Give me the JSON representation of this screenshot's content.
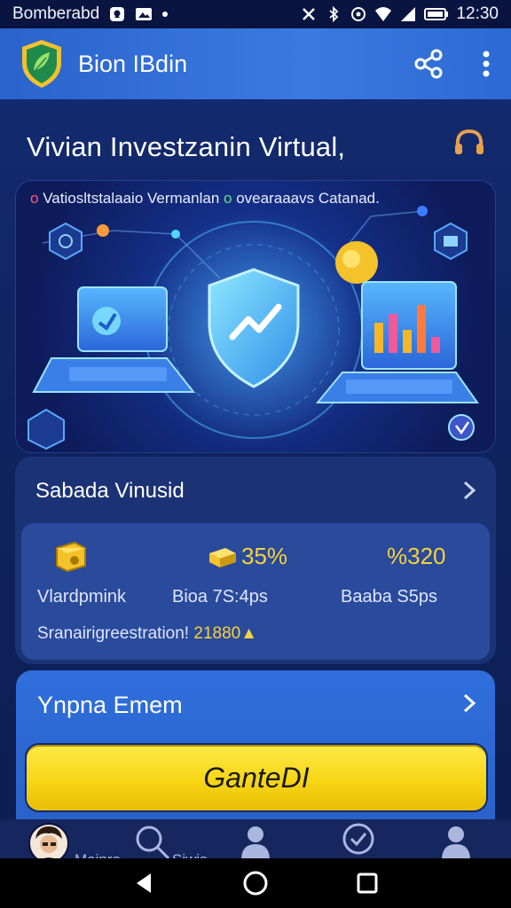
{
  "status_bar": {
    "carrier": "Bomberabd",
    "time": "12:30"
  },
  "app_bar": {
    "title": "Bion IBdin",
    "logo_icon": "shield-leaf-icon",
    "share_icon": "share-icon",
    "menu_icon": "more-vert-icon"
  },
  "main": {
    "headline": "Vivian Investzanin Virtual,",
    "headline_icon": "support-headset-icon",
    "hero": {
      "caption_part1": "Vatiosltstalaaio Vermanlan",
      "caption_part2": "ovearaaavs Catanad."
    },
    "card1": {
      "title": "Sabada Vinusid",
      "stats": [
        {
          "value": "",
          "label": "Vlardpmink",
          "icon": "coin-box-icon"
        },
        {
          "value": "35%",
          "label": "Bioa 7S:4ps",
          "icon": "gold-bars-icon"
        },
        {
          "value": "%320",
          "label": "Baaba S5ps",
          "icon": ""
        }
      ],
      "footer_text": "Sranairigreestration!",
      "footer_value": "21880▲"
    },
    "card2": {
      "title": "Ynpna Emem",
      "cta_label": "GanteDI"
    }
  },
  "bottom_nav": {
    "items": [
      {
        "label": "Moinre",
        "icon": "avatar"
      },
      {
        "label": "Siwis",
        "icon": "search-icon"
      },
      {
        "label": "",
        "icon": "user-icon"
      },
      {
        "label": "",
        "icon": "shield-check-icon"
      },
      {
        "label": "",
        "icon": "profile-icon"
      }
    ]
  },
  "colors": {
    "accent_yellow": "#f6d33b",
    "app_bar_blue": "#3a7ae0",
    "background_navy": "#0f1f5a"
  }
}
